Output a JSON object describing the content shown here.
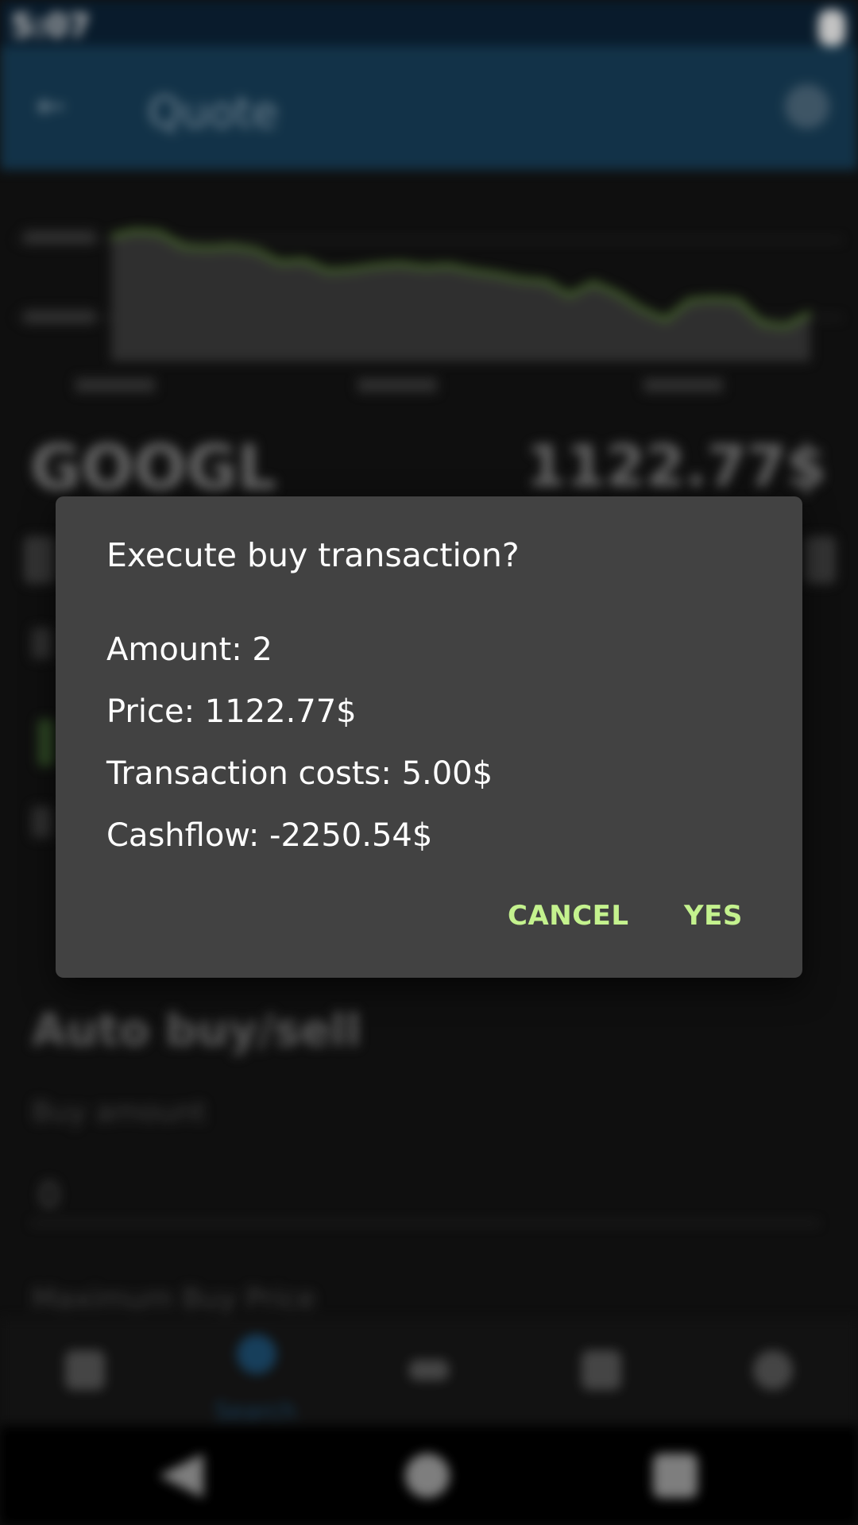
{
  "status_bar": {
    "time": "5:07"
  },
  "app_bar": {
    "title": "Quote"
  },
  "chart_data": {
    "type": "area",
    "x": [
      0,
      1,
      2,
      3,
      4,
      5,
      6,
      7,
      8,
      9,
      10,
      11,
      12,
      13,
      14,
      15,
      16,
      17,
      18,
      19,
      20,
      21,
      22,
      23,
      24,
      25,
      26,
      27,
      28,
      29
    ],
    "series": [
      {
        "values": [
          72,
          75,
          74,
          66,
          65,
          66,
          64,
          57,
          58,
          52,
          53,
          55,
          56,
          54,
          55,
          52,
          50,
          47,
          46,
          38,
          45,
          39,
          30,
          24,
          35,
          36,
          35,
          22,
          20,
          28
        ]
      }
    ],
    "color": "#5f8a3c"
  },
  "stock": {
    "symbol": "GOOGL",
    "price": "1122.77$"
  },
  "auto_section": {
    "title": "Auto buy/sell",
    "buy_amount_label": "Buy amount",
    "buy_amount_value": "0",
    "max_price_label": "Maximum Buy Price"
  },
  "bottom_nav": {
    "active_label": "Search"
  },
  "dialog": {
    "title": "Execute buy transaction?",
    "amount": "Amount: 2",
    "price": "Price: 1122.77$",
    "costs": "Transaction costs: 5.00$",
    "cashflow": "Cashflow: -2250.54$",
    "cancel_label": "CANCEL",
    "yes_label": "YES"
  },
  "colors": {
    "accent": "#c4f28e",
    "dialog_bg": "#424242",
    "app_bar": "#173e58"
  }
}
